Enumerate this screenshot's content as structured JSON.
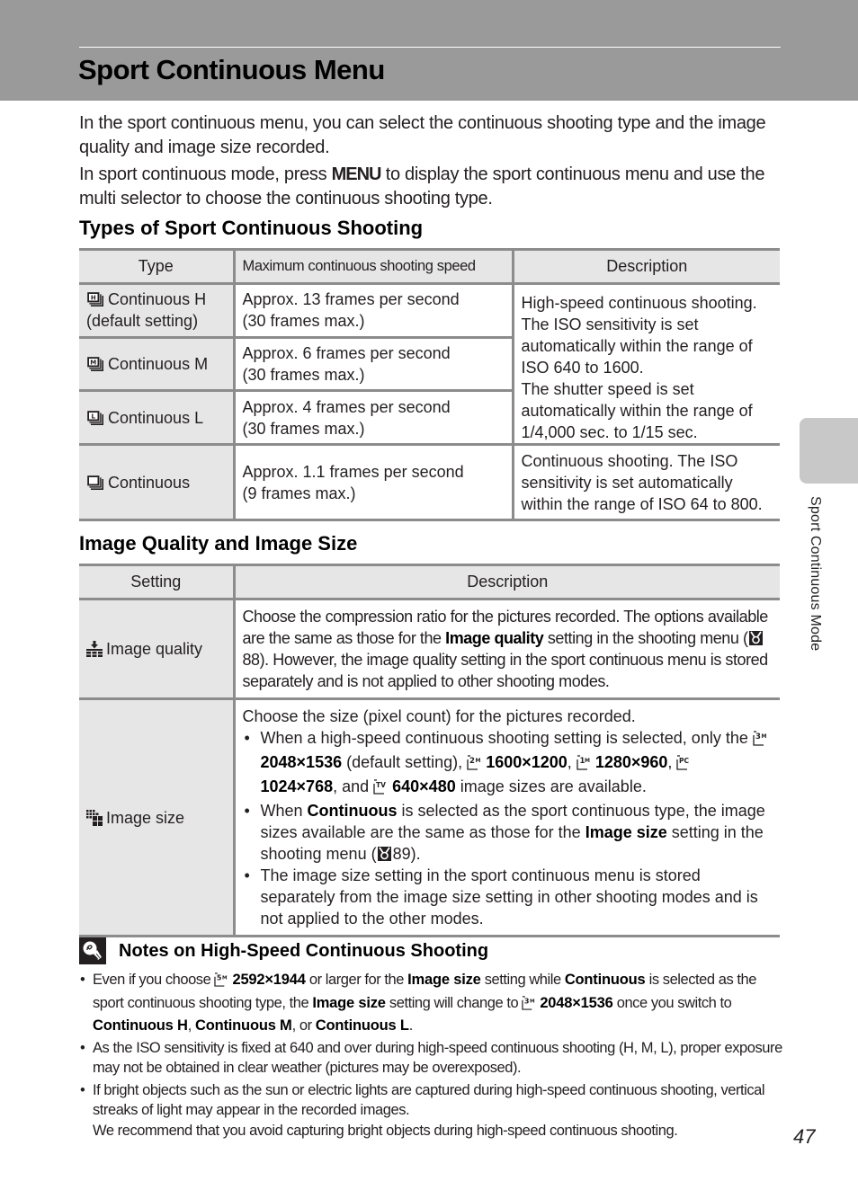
{
  "header": {
    "title": "Sport Continuous Menu"
  },
  "intro": {
    "paragraph_1": "In the sport continuous menu, you can select the continuous shooting type and the image quality and image size recorded.",
    "paragraph_2_before": "In sport continuous mode, press ",
    "paragraph_2_key": "MENU",
    "paragraph_2_after": " to display the sport continuous menu and use the multi selector to choose the continuous shooting type."
  },
  "types_section": {
    "heading": "Types of Sport Continuous Shooting",
    "columns": [
      "Type",
      "Maximum continuous shooting speed",
      "Description"
    ],
    "rows": [
      {
        "icon": "continuous-h-icon",
        "type": "Continuous H",
        "type_note": "(default setting)",
        "speed_1": "Approx. 13 frames per second",
        "speed_2": "(30 frames max.)"
      },
      {
        "icon": "continuous-m-icon",
        "type": "Continuous M",
        "speed_1": "Approx. 6 frames per second",
        "speed_2": "(30 frames max.)"
      },
      {
        "icon": "continuous-l-icon",
        "type": "Continuous L",
        "speed_1": "Approx. 4 frames per second",
        "speed_2": "(30 frames max.)"
      },
      {
        "icon": "continuous-icon",
        "type": "Continuous",
        "speed_1": "Approx. 1.1 frames per second",
        "speed_2": "(9 frames max.)"
      }
    ],
    "desc_high_speed": "High-speed continuous shooting. The ISO sensitivity is set automatically within the range of ISO 640 to 1600.",
    "desc_high_speed_2": "The shutter speed is set automatically within the range of 1/4,000 sec. to 1/15 sec.",
    "desc_continuous": "Continuous shooting. The ISO sensitivity is set automatically within the range of ISO 64 to 800."
  },
  "quality_section": {
    "heading": "Image Quality and Image Size",
    "columns": [
      "Setting",
      "Description"
    ],
    "image_quality": {
      "label": "Image quality",
      "text_1": "Choose the compression ratio for the pictures recorded. The options available are the same as those for the ",
      "bold_1": "Image quality",
      "text_2": " setting in the shooting menu (",
      "ref_page": "88",
      "text_3": "). However, the image quality setting in the sport continuous menu is stored separately and is not applied to other shooting modes."
    },
    "image_size": {
      "label": "Image size",
      "intro": "Choose the size (pixel count) for the pictures recorded.",
      "bullet_1_a": "When a high-speed continuous shooting setting is selected, only the ",
      "sizes": [
        {
          "code": "3M",
          "value": "2048×1536"
        },
        {
          "code": "2M",
          "value": "1600×1200"
        },
        {
          "code": "1M",
          "value": "1280×960"
        },
        {
          "code": "PC",
          "value": "1024×768"
        },
        {
          "code": "TV",
          "value": "640×480"
        }
      ],
      "default_note": " (default setting), ",
      "sep": ", ",
      "and": ", and ",
      "bullet_1_end": " image sizes are available.",
      "bullet_2_a": "When ",
      "bullet_2_bold_1": "Continuous",
      "bullet_2_b": " is selected as the sport continuous type, the image sizes available are the same as those for the ",
      "bullet_2_bold_2": "Image size",
      "bullet_2_c": " setting in the shooting menu (",
      "bullet_2_ref": "89",
      "bullet_2_d": ").",
      "bullet_3": "The image size setting in the sport continuous menu is stored separately from the image size setting in other shooting modes and is not applied to the other modes."
    }
  },
  "notes": {
    "title": "Notes on High-Speed Continuous Shooting",
    "note_1": {
      "a": "Even if you choose ",
      "size_code_1": "5M",
      "size_1": "2592×1944",
      "b": " or larger for the ",
      "bold_1": "Image size",
      "c": " setting while ",
      "bold_2": "Continuous",
      "d": " is selected as the sport continuous shooting type, the ",
      "bold_3": "Image size",
      "e": " setting will change to ",
      "size_code_2": "3M",
      "size_2": "2048×1536",
      "f": " once you switch to ",
      "bold_4": "Continuous H",
      "g": ", ",
      "bold_5": "Continuous M",
      "h": ", or ",
      "bold_6": "Continuous L",
      "i": "."
    },
    "note_2": "As the ISO sensitivity is fixed at 640 and over during high-speed continuous shooting (H, M, L), proper exposure may not be obtained in clear weather (pictures may be overexposed).",
    "note_3_a": "If bright objects such as the sun or electric lights are captured during high-speed continuous shooting, vertical streaks of light may appear in the recorded images.",
    "note_3_b": "We recommend that you avoid capturing bright objects during high-speed continuous shooting."
  },
  "side_tab": {
    "label": "Sport Continuous Mode"
  },
  "page_number": "47",
  "colors": {
    "header_band": "#9a9a9a",
    "table_header_bg": "#e6e6e6",
    "table_border": "#8c8c8c",
    "side_tab": "#c8c8c8"
  }
}
